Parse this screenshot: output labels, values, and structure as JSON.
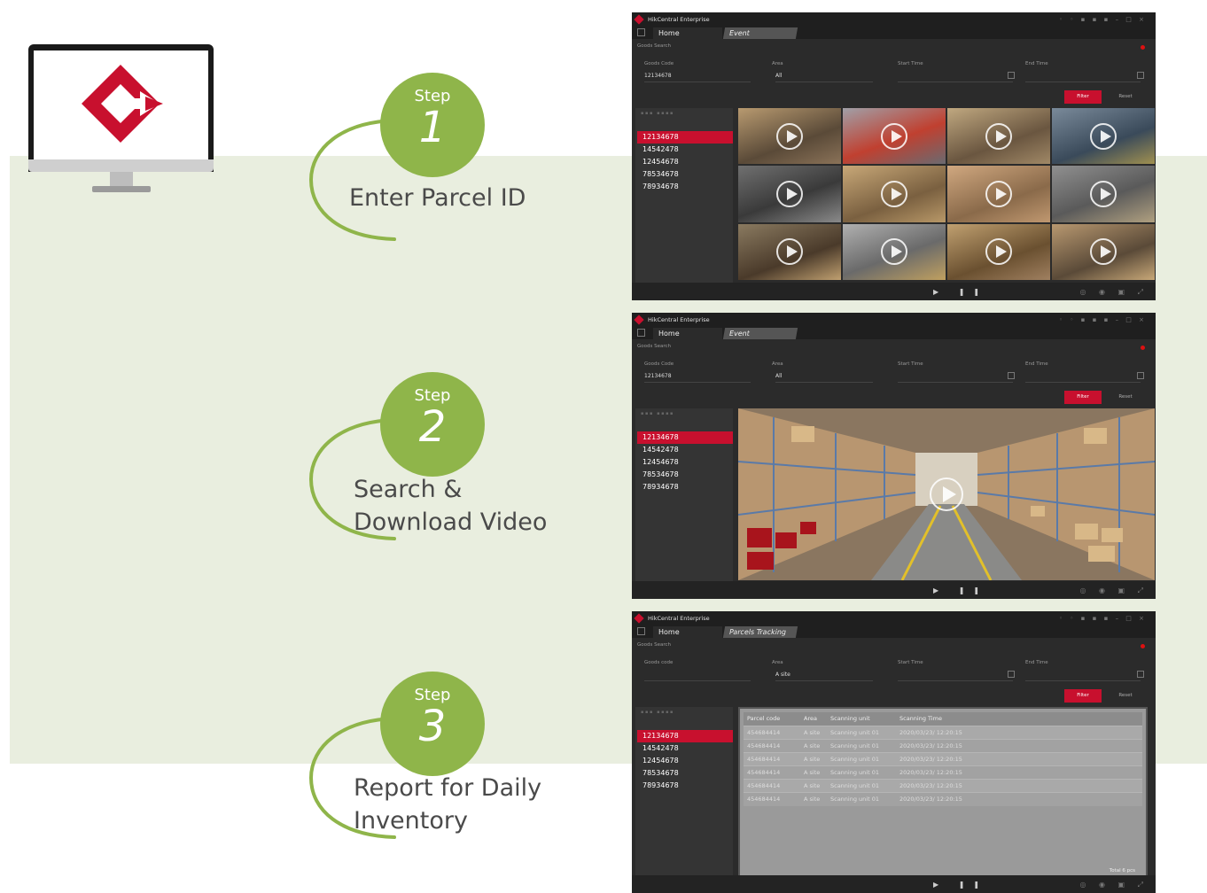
{
  "colors": {
    "accent_green": "#8fb54a",
    "band_green": "#e9eedf",
    "brand_red": "#c8102e"
  },
  "steps": [
    {
      "word": "Step",
      "number": "1",
      "title_lines": [
        "Enter Parcel ID"
      ]
    },
    {
      "word": "Step",
      "number": "2",
      "title_lines": [
        "Search &",
        "Download Video"
      ]
    },
    {
      "word": "Step",
      "number": "3",
      "title_lines": [
        "Report for Daily",
        "Inventory"
      ]
    }
  ],
  "windows": [
    {
      "app_title": "HikCentral Enterprise",
      "tab_home": "Home",
      "tab_active": "Event",
      "section": "Goods Search",
      "filters": {
        "goods_code_label": "Goods Code",
        "goods_code_value": "12134678",
        "area_label": "Area",
        "area_value": "All",
        "start_label": "Start Time",
        "end_label": "End Time"
      },
      "filter_button": "Filter",
      "reset_button": "Reset",
      "ids": [
        "12134678",
        "14542478",
        "12454678",
        "78534678",
        "78934678"
      ]
    },
    {
      "app_title": "HikCentral Enterprise",
      "tab_home": "Home",
      "tab_active": "Event",
      "section": "Goods Search",
      "filters": {
        "goods_code_label": "Goods Code",
        "goods_code_value": "12134678",
        "area_label": "Area",
        "area_value": "All",
        "start_label": "Start Time",
        "end_label": "End Time"
      },
      "filter_button": "Filter",
      "reset_button": "Reset",
      "ids": [
        "12134678",
        "14542478",
        "12454678",
        "78534678",
        "78934678"
      ]
    },
    {
      "app_title": "HikCentral Enterprise",
      "tab_home": "Home",
      "tab_active": "Parcels Tracking",
      "section": "Goods Search",
      "filters": {
        "goods_code_label": "Goods code",
        "goods_code_value": "",
        "area_label": "Area",
        "area_value": "A site",
        "start_label": "Start Time",
        "end_label": "End Time"
      },
      "filter_button": "Filter",
      "reset_button": "Reset",
      "ids": [
        "12134678",
        "14542478",
        "12454678",
        "78534678",
        "78934678"
      ],
      "table": {
        "headers": [
          "Parcel code",
          "Area",
          "Scanning unit",
          "Scanning Time"
        ],
        "rows": [
          [
            "454684414",
            "A site",
            "Scanning unit 01",
            "2020/03/23/ 12:20:15"
          ],
          [
            "454684414",
            "A site",
            "Scanning unit 01",
            "2020/03/23/ 12:20:15"
          ],
          [
            "454684414",
            "A site",
            "Scanning unit 01",
            "2020/03/23/ 12:20:15"
          ],
          [
            "454684414",
            "A site",
            "Scanning unit 01",
            "2020/03/23/ 12:20:15"
          ],
          [
            "454684414",
            "A site",
            "Scanning unit 01",
            "2020/03/23/ 12:20:15"
          ],
          [
            "454684414",
            "A site",
            "Scanning unit 01",
            "2020/03/23/ 12:20:15"
          ]
        ],
        "total": "Total 6 pcs"
      }
    }
  ]
}
